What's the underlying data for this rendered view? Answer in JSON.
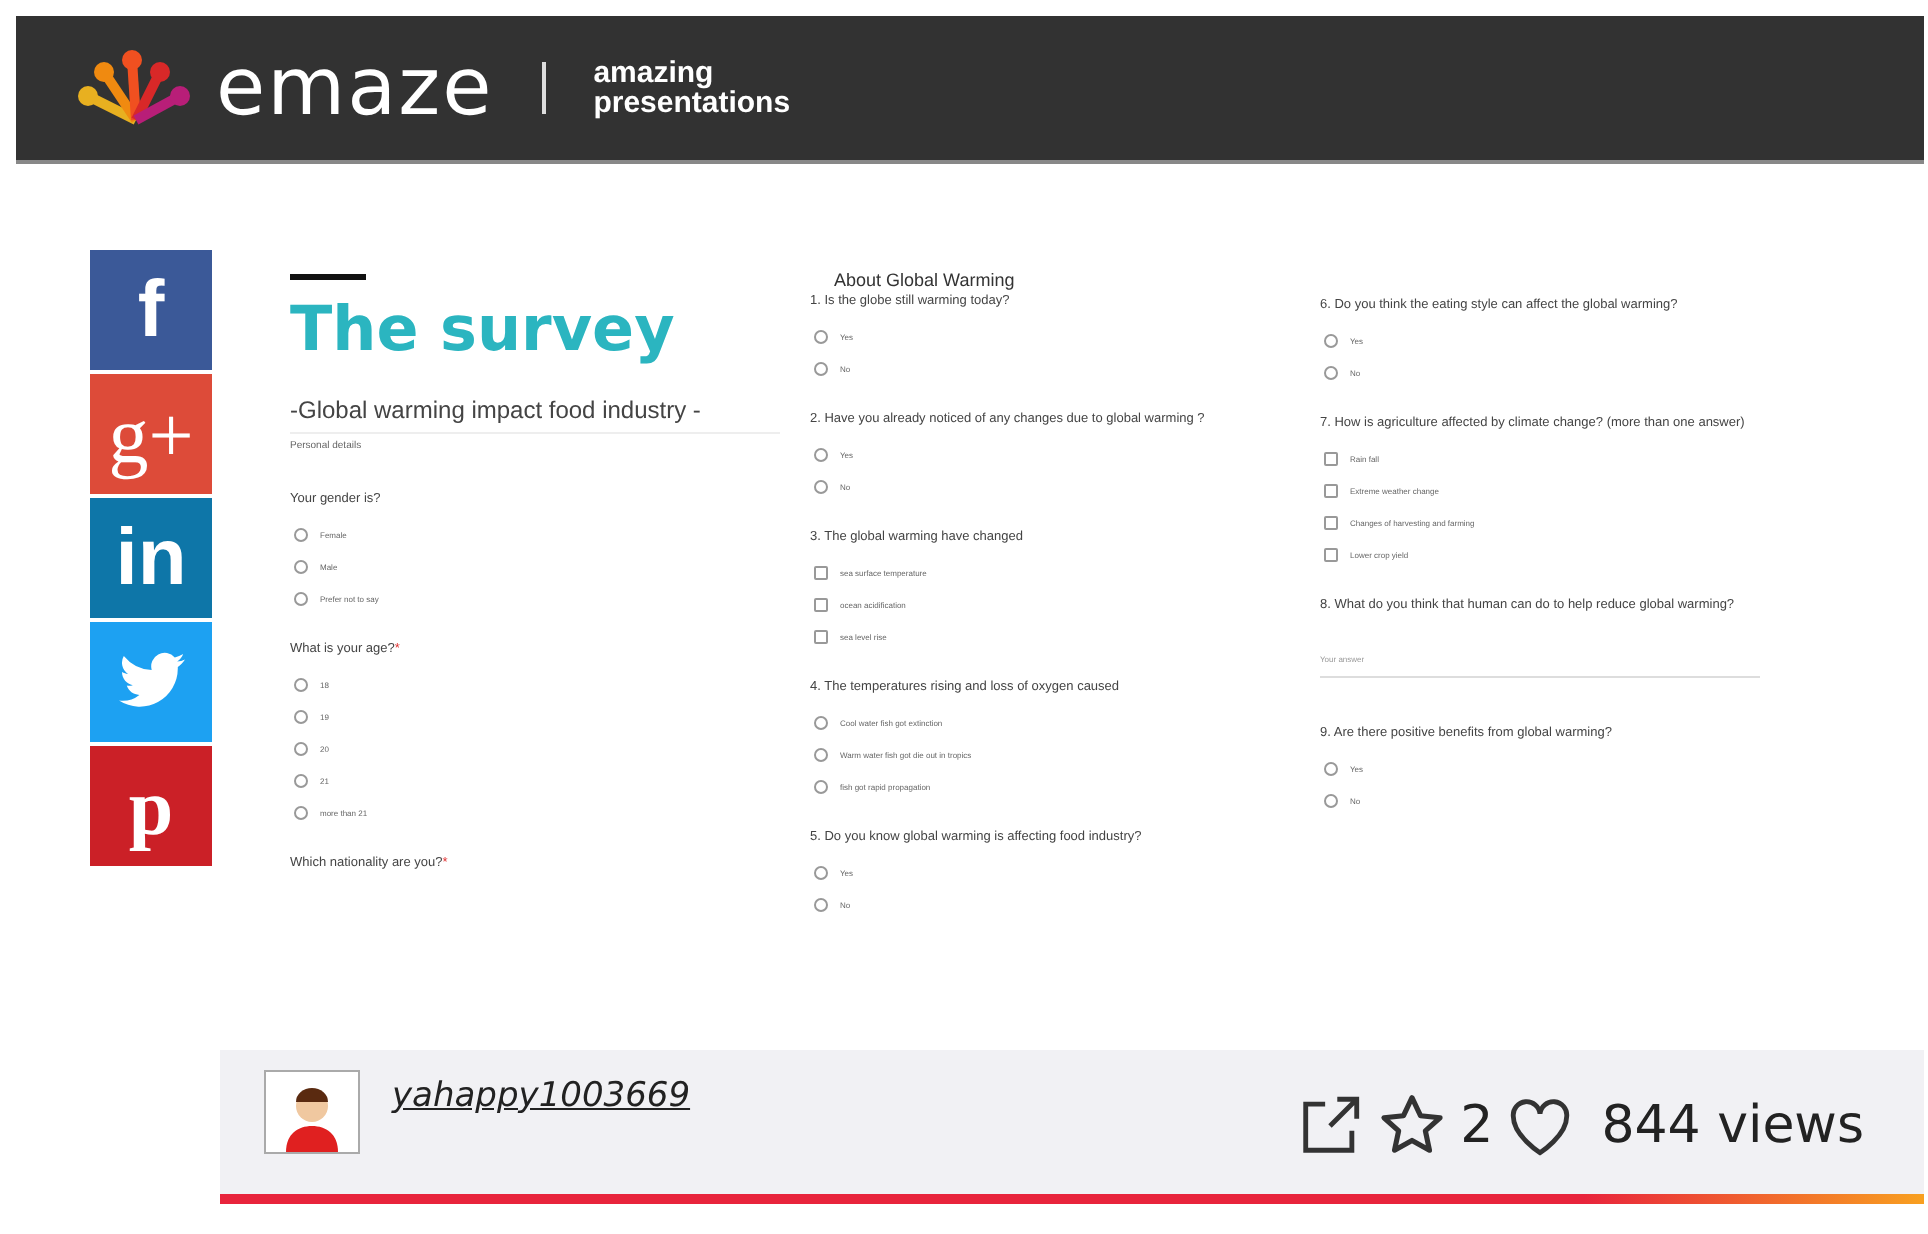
{
  "header": {
    "brand": "emaze",
    "tagline_1": "amazing",
    "tagline_2": "presentations"
  },
  "social": [
    {
      "kind": "facebook",
      "glyph": "f",
      "color": "#3b5998"
    },
    {
      "kind": "google-plus",
      "glyph": "g+",
      "color": "#dd4b39"
    },
    {
      "kind": "linkedin",
      "glyph": "in",
      "color": "#0e76a8"
    },
    {
      "kind": "twitter",
      "color": "#1da1f2"
    },
    {
      "kind": "pinterest",
      "glyph": "p",
      "color": "#cb2027"
    }
  ],
  "slide": {
    "title": "The survey",
    "subtitle": "-Global warming impact food industry -",
    "section": "Personal details",
    "columns": [
      {
        "questions": [
          {
            "text": "Your gender is?",
            "kind": "radio",
            "options": [
              {
                "label": "Female",
                "selected": false
              },
              {
                "label": "Male",
                "selected": false
              },
              {
                "label": "Prefer not to say",
                "selected": false
              }
            ]
          },
          {
            "text": "What is your age?",
            "required_mark": "*",
            "kind": "radio",
            "options": [
              {
                "label": "18",
                "selected": false
              },
              {
                "label": "19",
                "selected": false
              },
              {
                "label": "20",
                "selected": false
              },
              {
                "label": "21",
                "selected": false
              },
              {
                "label": "more than 21",
                "selected": false
              }
            ]
          },
          {
            "text": "Which nationality are you?",
            "required_mark": "*",
            "kind": "radio"
          }
        ]
      },
      {
        "heading": "About Global Warming",
        "questions": [
          {
            "text": "1. Is the globe still warming today?",
            "kind": "radio",
            "options": [
              {
                "label": "Yes",
                "selected": false
              },
              {
                "label": "No",
                "selected": false
              }
            ]
          },
          {
            "text": "2. Have you already noticed of any changes due to global warming ?",
            "kind": "radio",
            "options": [
              {
                "label": "Yes",
                "selected": false
              },
              {
                "label": "No",
                "selected": false
              }
            ]
          },
          {
            "text": "3. The global warming have changed",
            "kind": "checkbox",
            "options": [
              {
                "label": "sea surface temperature",
                "selected": false
              },
              {
                "label": "ocean acidification",
                "selected": false
              },
              {
                "label": "sea level rise",
                "selected": false
              }
            ]
          },
          {
            "text": "4. The temperatures rising and loss of oxygen caused",
            "kind": "radio",
            "options": [
              {
                "label": "Cool water fish got extinction",
                "selected": false
              },
              {
                "label": "Warm water fish got die out in tropics",
                "selected": false
              },
              {
                "label": "fish got rapid propagation",
                "selected": false
              }
            ]
          },
          {
            "text": "5. Do you know global warming is affecting food industry?",
            "kind": "radio",
            "options": [
              {
                "label": "Yes",
                "selected": false
              },
              {
                "label": "No",
                "selected": false
              }
            ]
          }
        ]
      },
      {
        "questions": [
          {
            "text": "6. Do you think the eating style can affect the global warming?",
            "kind": "radio",
            "options": [
              {
                "label": "Yes",
                "selected": false
              },
              {
                "label": "No",
                "selected": false
              }
            ]
          },
          {
            "text": "7. How is agriculture affected by climate change? (more than one answer)",
            "kind": "checkbox",
            "options": [
              {
                "label": "Rain fall",
                "selected": false
              },
              {
                "label": "Extreme weather change",
                "selected": false
              },
              {
                "label": "Changes of harvesting and farming",
                "selected": false
              },
              {
                "label": "Lower crop yield",
                "selected": false
              }
            ]
          },
          {
            "text": "8.  What do you think that human can do to help reduce global warming?",
            "kind": "text",
            "placeholder": "Your answer"
          },
          {
            "text": "9. Are there positive benefits from global warming?",
            "kind": "radio",
            "options": [
              {
                "label": "Yes",
                "selected": false
              },
              {
                "label": "No",
                "selected": false
              }
            ]
          }
        ]
      }
    ]
  },
  "footer": {
    "user": "yahappy1003669",
    "likes": "2",
    "views": "844 views"
  }
}
